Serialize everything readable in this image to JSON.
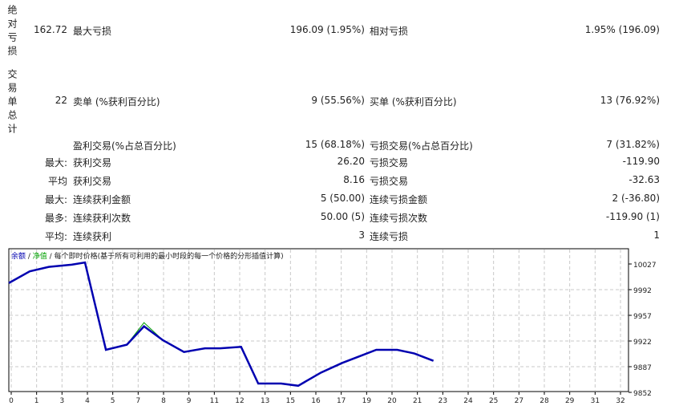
{
  "sections": [
    {
      "title": "绝对亏损"
    },
    {
      "title": "交易单总计"
    }
  ],
  "rows": [
    {
      "c1": "162.72",
      "c2": "最大亏损",
      "c3": "196.09 (1.95%)",
      "c4": "相对亏损",
      "c5": "1.95% (196.09)"
    },
    {
      "c1": "22",
      "c2": "卖单 (%获利百分比)",
      "c3": "9 (55.56%)",
      "c4": "买单 (%获利百分比)",
      "c5": "13 (76.92%)"
    },
    {
      "c1": "",
      "c2": "盈利交易(%占总百分比)",
      "c3": "15 (68.18%)",
      "c4": "亏损交易(%占总百分比)",
      "c5": "7 (31.82%)"
    },
    {
      "c1": "最大:",
      "c2": "获利交易",
      "c3": "26.20",
      "c4": "亏损交易",
      "c5": "-119.90"
    },
    {
      "c1": "平均",
      "c2": "获利交易",
      "c3": "8.16",
      "c4": "亏损交易",
      "c5": "-32.63"
    },
    {
      "c1": "最大:",
      "c2": "连续获利金额",
      "c3": "5 (50.00)",
      "c4": "连续亏损金额",
      "c5": "2 (-36.80)"
    },
    {
      "c1": "最多:",
      "c2": "连续获利次数",
      "c3": "50.00 (5)",
      "c4": "连续亏损次数",
      "c5": "-119.90 (1)"
    },
    {
      "c1": "平均:",
      "c2": "连续获利",
      "c3": "3",
      "c4": "连续亏损",
      "c5": "1"
    }
  ],
  "chart_data": {
    "type": "line",
    "legend": {
      "balance": "余额",
      "sep1": " / ",
      "equity": "净值",
      "sep2": " / ",
      "desc": "每个即时价格(基于所有可利用的最小时段的每一个价格的分形插值计算)"
    },
    "colors": {
      "balance": "#0000b0",
      "equity": "#00a000",
      "grid": "#c8c8c8"
    },
    "xlim": [
      0,
      32
    ],
    "ylim": [
      9852,
      10027
    ],
    "xticks": [
      0,
      1,
      3,
      4,
      5,
      7,
      8,
      9,
      11,
      12,
      13,
      15,
      16,
      17,
      19,
      20,
      21,
      23,
      24,
      25,
      27,
      28,
      29,
      31,
      32
    ],
    "yticks": [
      10027,
      9992,
      9957,
      9922,
      9887,
      9852
    ],
    "series": [
      {
        "name": "余额",
        "x": [
          0,
          1.1,
          2.1,
          3.3,
          4.0,
          5.1,
          6.2,
          7.1,
          8.1,
          9.2,
          10.3,
          11.1,
          12.2,
          13.1,
          14.3,
          15.2,
          16.4,
          17.5,
          18.5,
          19.3,
          20.4,
          21.3,
          22.3
        ],
        "y": [
          10001,
          10017,
          10023,
          10026,
          10029,
          9910,
          9917,
          9942,
          9923,
          9907,
          9912,
          9912,
          9914,
          9864,
          9864,
          9861,
          9879,
          9892,
          9902,
          9910,
          9910,
          9905,
          9895
        ]
      },
      {
        "name": "净值",
        "x": [
          0,
          1.1,
          2.1,
          3.3,
          4.0,
          5.1,
          6.2,
          7.1,
          8.1,
          9.2,
          10.3,
          11.1,
          12.2,
          13.1,
          14.3,
          15.2,
          16.4,
          17.5,
          18.5,
          19.3,
          20.4,
          21.3,
          22.3
        ],
        "y": [
          10001,
          10017,
          10023,
          10026,
          10029,
          9910,
          9917,
          9947,
          9923,
          9907,
          9912,
          9912,
          9914,
          9864,
          9864,
          9861,
          9879,
          9892,
          9902,
          9910,
          9910,
          9905,
          9895
        ]
      }
    ]
  }
}
